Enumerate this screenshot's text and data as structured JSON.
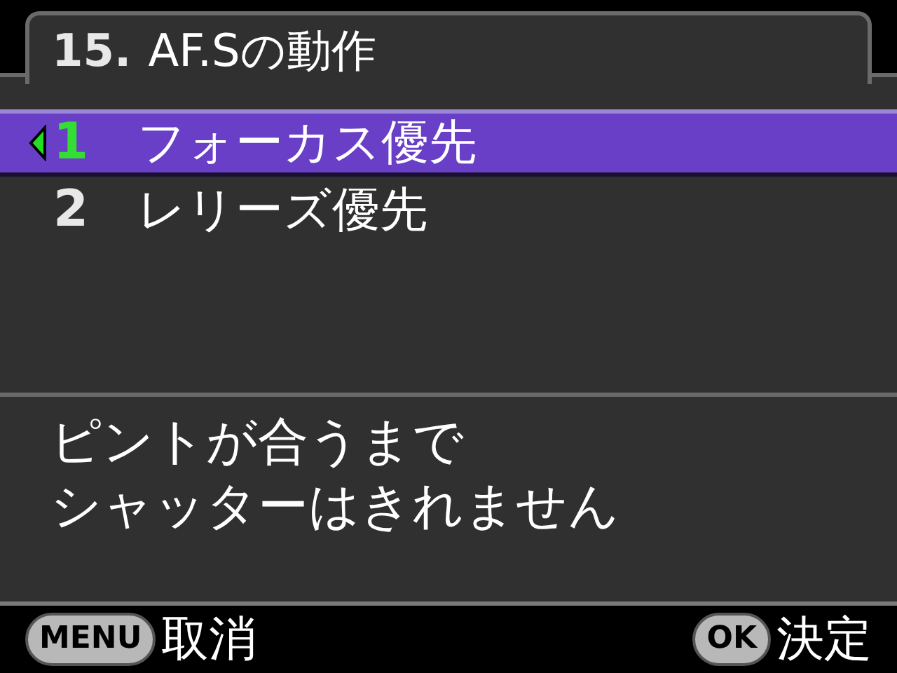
{
  "title": {
    "number": "15.",
    "text": "AF.Sの動作"
  },
  "options": [
    {
      "number": "1",
      "label": "フォーカス優先",
      "selected": true
    },
    {
      "number": "2",
      "label": "レリーズ優先",
      "selected": false
    }
  ],
  "description": [
    "ピントが合うまで",
    "シャッターはきれません"
  ],
  "footer": [
    {
      "key": "MENU",
      "label": "取消"
    },
    {
      "key": "OK",
      "label": "決定"
    }
  ]
}
